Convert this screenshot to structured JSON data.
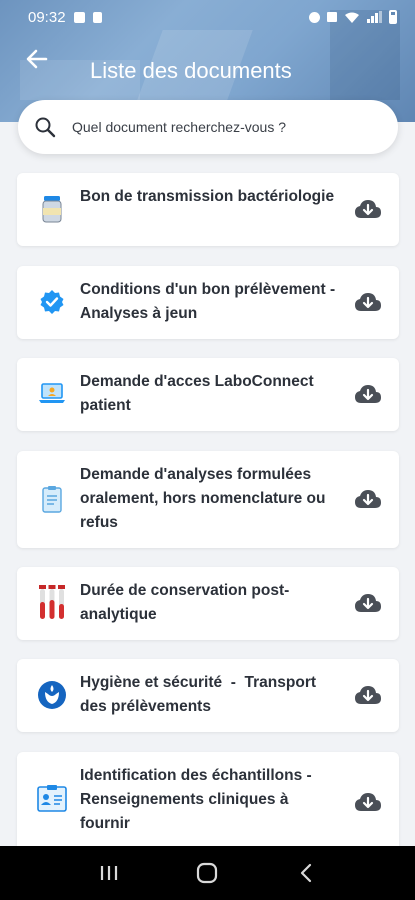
{
  "status_bar": {
    "time": "09:32"
  },
  "header": {
    "title": "Liste des documents",
    "back_icon": "arrow-left-icon"
  },
  "search": {
    "placeholder": "Quel document recherchez-vous ?",
    "value": ""
  },
  "documents": [
    {
      "label": "Bon de transmission bactériologie",
      "icon": "specimen-jar-icon",
      "download_icon": "cloud-download-icon"
    },
    {
      "label": "Conditions d'un bon prélèvement - Analyses à jeun",
      "icon": "verified-badge-icon",
      "download_icon": "cloud-download-icon"
    },
    {
      "label": "Demande d'acces LaboConnect patient",
      "icon": "laptop-icon",
      "download_icon": "cloud-download-icon"
    },
    {
      "label": "Demande d'analyses formulées oralement, hors nomenclature ou refus",
      "icon": "clipboard-icon",
      "download_icon": "cloud-download-icon"
    },
    {
      "label": "Durée de conservation post-analytique",
      "icon": "test-tubes-icon",
      "download_icon": "cloud-download-icon"
    },
    {
      "label": "Hygiène et sécurité  -  Transport des prélèvements",
      "icon": "hygiene-hand-icon",
      "download_icon": "cloud-download-icon"
    },
    {
      "label": "Identification des échantillons - Renseignements cliniques à fournir",
      "icon": "id-card-icon",
      "download_icon": "cloud-download-icon"
    }
  ],
  "colors": {
    "accent_icon": "#1e88e5",
    "download_icon": "#4a4f57",
    "text": "#2c313a"
  }
}
